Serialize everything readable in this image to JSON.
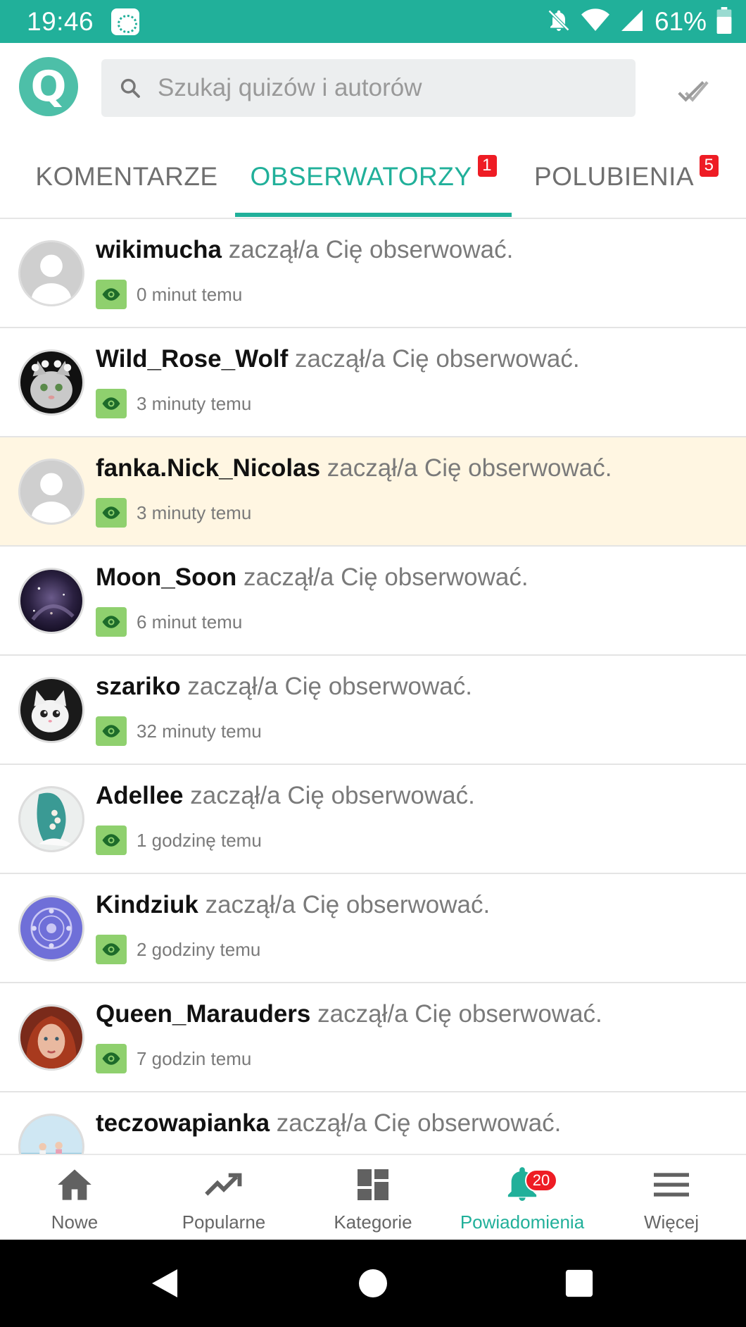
{
  "status_bar": {
    "time": "19:46",
    "battery": "61%",
    "icons": [
      "app-icon",
      "bell-off-icon",
      "wifi-icon",
      "signal-icon",
      "battery-icon"
    ]
  },
  "header": {
    "logo_letter": "Q",
    "search_placeholder": "Szukaj quizów i autorów"
  },
  "tabs": [
    {
      "label": "KOMENTARZE",
      "badge": "",
      "active": false
    },
    {
      "label": "OBSERWATORZY",
      "badge": "1",
      "active": true
    },
    {
      "label": "POLUBIENIA",
      "badge": "5",
      "active": false
    }
  ],
  "notifications": [
    {
      "username": "wikimucha",
      "action": "zaczął/a Cię obserwować.",
      "time": "0 minut temu",
      "avatar": "default"
    },
    {
      "username": "Wild_Rose_Wolf",
      "action": "zaczął/a Cię obserwować.",
      "time": "3 minuty temu",
      "avatar": "cat-flowers"
    },
    {
      "username": "fanka.Nick_Nicolas",
      "action": "zaczął/a Cię obserwować.",
      "time": "3 minuty temu",
      "avatar": "default",
      "highlighted": true
    },
    {
      "username": "Moon_Soon",
      "action": "zaczął/a Cię obserwować.",
      "time": "6 minut temu",
      "avatar": "galaxy"
    },
    {
      "username": "szariko",
      "action": "zaczął/a Cię obserwować.",
      "time": "32 minuty temu",
      "avatar": "white-cat"
    },
    {
      "username": "Adellee",
      "action": "zaczął/a Cię obserwować.",
      "time": "1 godzinę temu",
      "avatar": "braid"
    },
    {
      "username": "Kindziuk",
      "action": "zaczął/a Cię obserwować.",
      "time": "2 godziny temu",
      "avatar": "purple-pattern"
    },
    {
      "username": "Queen_Marauders",
      "action": "zaczął/a Cię obserwować.",
      "time": "7 godzin temu",
      "avatar": "red-hair-girl"
    },
    {
      "username": "teczowapianka",
      "action": "zaczął/a Cię obserwować.",
      "time": "",
      "avatar": "beach"
    }
  ],
  "bottom_nav": [
    {
      "label": "Nowe",
      "icon": "home-icon"
    },
    {
      "label": "Popularne",
      "icon": "trending-icon"
    },
    {
      "label": "Kategorie",
      "icon": "dashboard-icon"
    },
    {
      "label": "Powiadomienia",
      "icon": "bell-icon",
      "badge": "20",
      "active": true
    },
    {
      "label": "Więcej",
      "icon": "menu-icon"
    }
  ],
  "colors": {
    "accent": "#21b09a",
    "badge": "#ee1c24",
    "eye_badge": "#8fd06e",
    "highlight_row": "#fff6e2"
  }
}
